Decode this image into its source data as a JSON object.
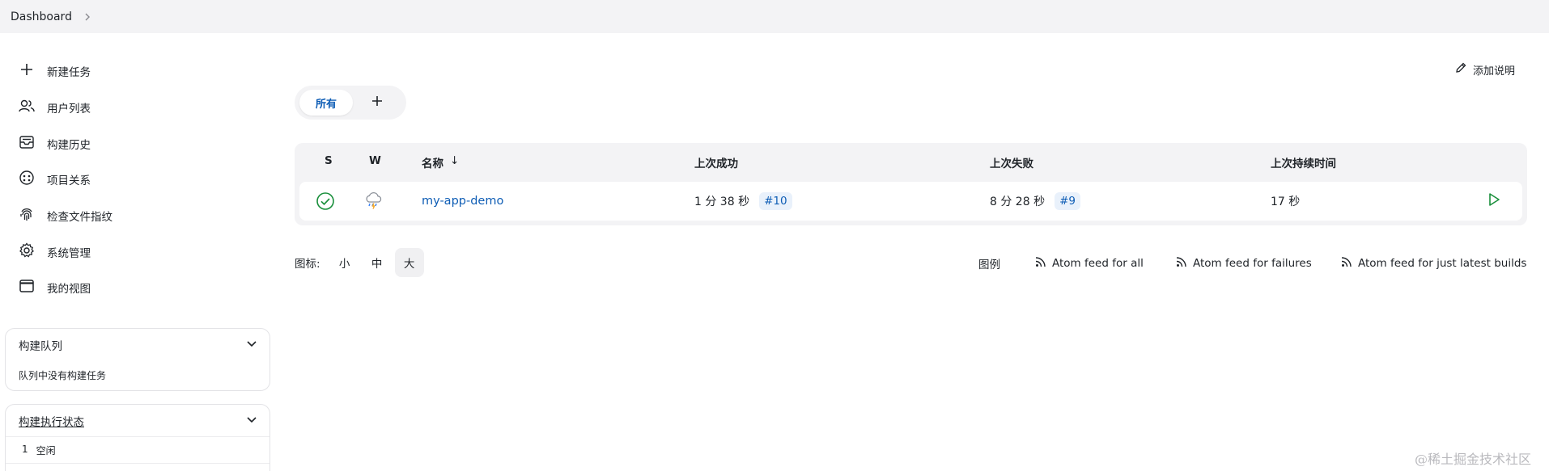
{
  "breadcrumb": {
    "root": "Dashboard"
  },
  "sidebar": {
    "items": [
      {
        "label": "新建任务",
        "icon": "plus-icon"
      },
      {
        "label": "用户列表",
        "icon": "users-icon"
      },
      {
        "label": "构建历史",
        "icon": "inbox-history-icon"
      },
      {
        "label": "项目关系",
        "icon": "relations-icon"
      },
      {
        "label": "检查文件指纹",
        "icon": "fingerprint-icon"
      },
      {
        "label": "系统管理",
        "icon": "gear-icon"
      },
      {
        "label": "我的视图",
        "icon": "window-icon"
      }
    ],
    "queue": {
      "title": "构建队列",
      "message": "队列中没有构建任务"
    },
    "executors": {
      "title": "构建执行状态",
      "items": [
        {
          "index": "1",
          "status": "空闲"
        }
      ]
    }
  },
  "main": {
    "add_description": "添加说明",
    "tabs": [
      {
        "label": "所有",
        "active": true
      }
    ],
    "table": {
      "headers": {
        "s": "S",
        "w": "W",
        "name": "名称",
        "sort_arrow": "↓",
        "last_success": "上次成功",
        "last_failure": "上次失败",
        "last_duration": "上次持续时间"
      },
      "rows": [
        {
          "status": "success",
          "weather": "storm",
          "name": "my-app-demo",
          "last_success": "1 分 38 秒",
          "last_success_build": "#10",
          "last_failure": "8 分 28 秒",
          "last_failure_build": "#9",
          "last_duration": "17 秒"
        }
      ]
    },
    "icon_size": {
      "label": "图标:",
      "options": [
        "小",
        "中",
        "大"
      ],
      "selected": "大"
    },
    "legend": "图例",
    "feeds": {
      "all": "Atom feed for all",
      "failures": "Atom feed for failures",
      "latest": "Atom feed for just latest builds"
    }
  },
  "watermark": "@稀土掘金技术社区",
  "colors": {
    "link": "#0e5db5",
    "success": "#1a8f3c",
    "panel_bg": "#f3f3f5"
  }
}
